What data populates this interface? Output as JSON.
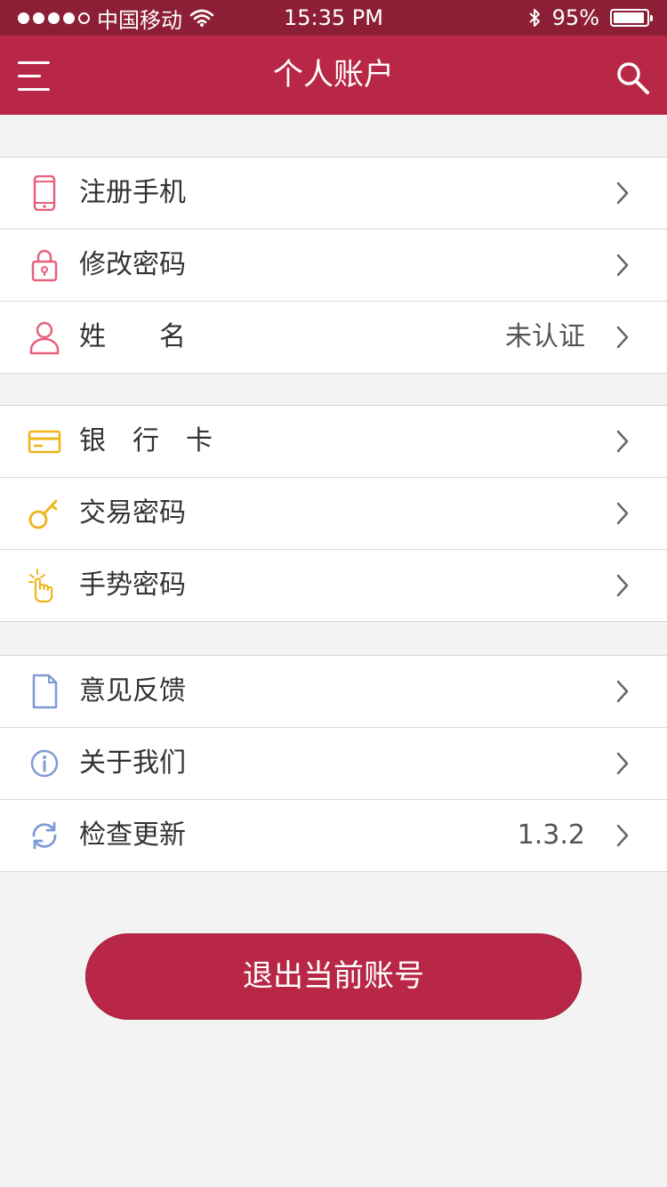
{
  "status_bar": {
    "carrier": "中国移动",
    "time": "15:35 PM",
    "battery": "95%",
    "battery_level": 0.95,
    "signal_dots_filled": 4,
    "signal_dots_total": 5
  },
  "nav": {
    "title": "个人账户",
    "menu_icon": "menu-icon",
    "search_icon": "search-icon"
  },
  "groups": [
    {
      "items": [
        {
          "id": "phone",
          "label": "注册手机",
          "value": "",
          "icon": "phone-icon",
          "color": "#e8607c"
        },
        {
          "id": "password",
          "label": "修改密码",
          "value": "",
          "icon": "lock-icon",
          "color": "#e8607c"
        },
        {
          "id": "name",
          "label": "姓　　名",
          "value": "未认证",
          "icon": "user-icon",
          "color": "#e8607c"
        }
      ]
    },
    {
      "items": [
        {
          "id": "bankcard",
          "label": "银　行　卡",
          "value": "",
          "icon": "card-icon",
          "color": "#f0b418"
        },
        {
          "id": "trade-password",
          "label": "交易密码",
          "value": "",
          "icon": "key-icon",
          "color": "#f0b418"
        },
        {
          "id": "gesture-password",
          "label": "手势密码",
          "value": "",
          "icon": "gesture-icon",
          "color": "#f0b418"
        }
      ]
    },
    {
      "items": [
        {
          "id": "feedback",
          "label": "意见反馈",
          "value": "",
          "icon": "document-icon",
          "color": "#7f9bd6"
        },
        {
          "id": "about",
          "label": "关于我们",
          "value": "",
          "icon": "info-icon",
          "color": "#7f9bd6"
        },
        {
          "id": "update",
          "label": "检查更新",
          "value": "1.3.2",
          "icon": "refresh-icon",
          "color": "#7f9bd6"
        }
      ]
    }
  ],
  "logout_label": "退出当前账号",
  "colors": {
    "status_bar": "#8c1f36",
    "nav_bar": "#b82846",
    "accent": "#b82846",
    "background": "#f3f3f3"
  }
}
